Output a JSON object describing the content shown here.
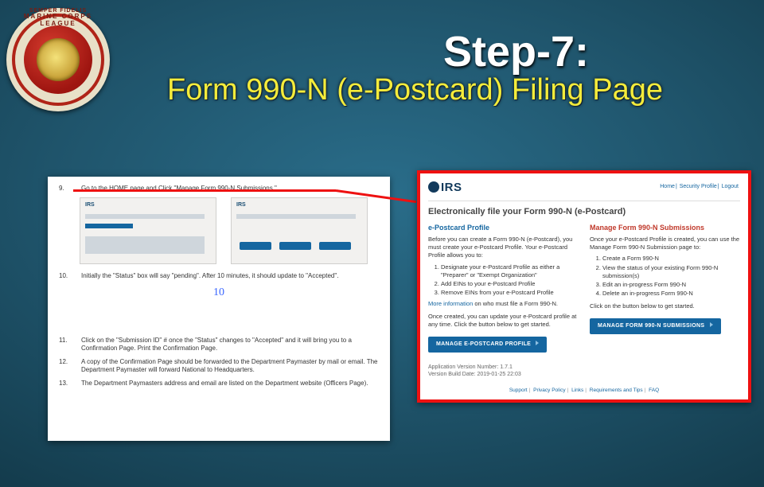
{
  "emblem": {
    "top_text": "MARINE CORPS LEAGUE",
    "bottom_text": "SEMPER FIDELIS"
  },
  "headline": {
    "step": "Step-7:",
    "subtitle": "Form 990-N (e-Postcard) Filing Page"
  },
  "left": {
    "items": [
      {
        "n": "9.",
        "t": "Go to the HOME page and Click \"Manage Form 990-N Submissions.\""
      },
      {
        "n": "10.",
        "t": "Initially the \"Status\" box will say \"pending\". After 10 minutes, it should update to \"Accepted\"."
      },
      {
        "n": "11.",
        "t": "Click on the \"Submission ID\" # once the \"Status\" changes to \"Accepted\" and it will bring you to a Confirmation Page. Print the Confirmation Page."
      },
      {
        "n": "12.",
        "t": "A copy of the Confirmation Page should be forwarded to the Department Paymaster by mail or email. The Department Paymaster will forward National to Headquarters."
      },
      {
        "n": "13.",
        "t": "The Department Paymasters address and email are listed on the Department website (Officers Page)."
      }
    ],
    "big_num": "10",
    "mini_logo": "IRS"
  },
  "right": {
    "logo": "IRS",
    "top_links": [
      "Home",
      "Security Profile",
      "Logout"
    ],
    "title": "Electronically file your Form 990-N (e-Postcard)",
    "left_col": {
      "heading": "e-Postcard Profile",
      "intro": "Before you can create a Form 990-N (e-Postcard), you must create your e-Postcard Profile. Your e-Postcard Profile allows you to:",
      "list": [
        "Designate your e-Postcard Profile as either a \"Preparer\" or \"Exempt Organization\"",
        "Add EINs to your e-Postcard Profile",
        "Remove EINs from your e-Postcard Profile"
      ],
      "more_info_label": "More information",
      "more_info_tail": " on who must file a Form 990-N.",
      "below": "Once created, you can update your e-Postcard profile at any time. Click the button below to get started.",
      "cta": "MANAGE E-POSTCARD PROFILE"
    },
    "right_col": {
      "heading": "Manage Form 990-N Submissions",
      "intro": "Once your e-Postcard Profile is created, you can use the Manage Form 990-N Submission page to:",
      "list": [
        "Create a Form 990-N",
        "View the status of your existing Form 990-N submission(s)",
        "Edit an in-progress Form 990-N",
        "Delete an in-progress Form 990-N"
      ],
      "below": "Click on the button below to get started.",
      "cta": "MANAGE FORM 990-N SUBMISSIONS"
    },
    "meta": {
      "version_label": "Application Version Number:",
      "version_value": "1.7.1",
      "build_label": "Version Build Date:",
      "build_value": "2019-01-25 22:03"
    },
    "footer_links": [
      "Support",
      "Privacy Policy",
      "Links",
      "Requirements and Tips",
      "FAQ"
    ]
  }
}
